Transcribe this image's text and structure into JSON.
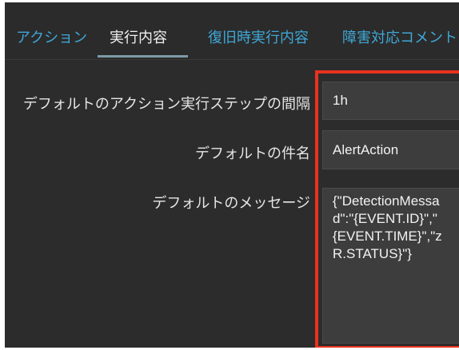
{
  "tabs": [
    {
      "label": "アクション"
    },
    {
      "label": "実行内容"
    },
    {
      "label": "復旧時実行内容"
    },
    {
      "label": "障害対応コメント"
    }
  ],
  "active_tab": "実行内容",
  "form": {
    "step_interval": {
      "label": "デフォルトのアクション実行ステップの間隔",
      "value": "1h"
    },
    "subject": {
      "label": "デフォルトの件名",
      "value": "AlertAction"
    },
    "message": {
      "label": "デフォルトのメッセージ",
      "lines": [
        "{\"DetectionMessa",
        "d\":\"{EVENT.ID}\",\"",
        "{EVENT.TIME}\",\"z",
        "R.STATUS}\"}"
      ]
    }
  },
  "colors": {
    "background": "#2c2c2c",
    "tab_inactive": "#3fa7d6",
    "tab_active": "#f0f0f0",
    "field_bg": "#3d3d3d",
    "highlight": "#e8321f"
  }
}
